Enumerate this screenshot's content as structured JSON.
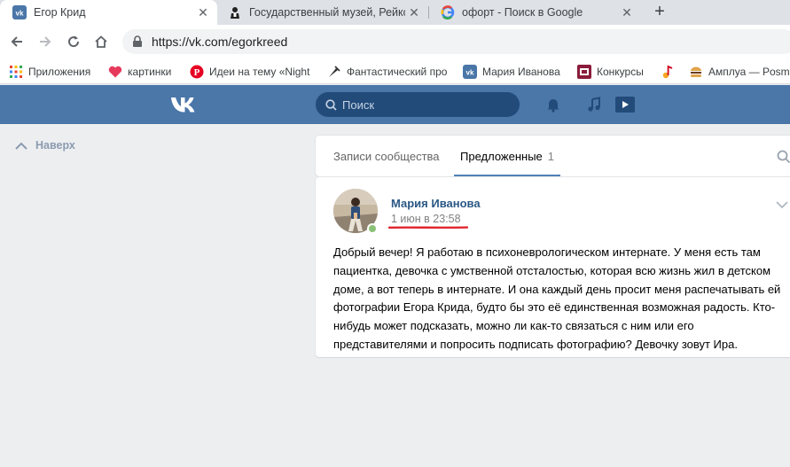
{
  "browser": {
    "tabs": [
      {
        "title": "Егор Крид",
        "icon": "vk-favicon",
        "active": true
      },
      {
        "title": "Государственный музей, Рейксмюсеум",
        "icon": "museum-favicon",
        "active": false
      },
      {
        "title": "офорт - Поиск в Google",
        "icon": "google-favicon",
        "active": false
      }
    ],
    "close_glyph": "✕",
    "newtab_glyph": "+",
    "url": "https://vk.com/egorkreed",
    "bookmarks": [
      {
        "label": "Приложения",
        "icon": "apps-grid-icon"
      },
      {
        "label": "картинки",
        "icon": "heart-icon"
      },
      {
        "label": "Идеи на тему «Night",
        "icon": "pinterest-icon"
      },
      {
        "label": "Фантастический про",
        "icon": "fantasy-icon"
      },
      {
        "label": "Мария Иванова",
        "icon": "vk-icon"
      },
      {
        "label": "Конкурсы",
        "icon": "contest-icon"
      },
      {
        "label": "",
        "icon": "music-note-icon"
      },
      {
        "label": "Амплуа — Posm",
        "icon": "burger-icon"
      }
    ]
  },
  "vk": {
    "search_placeholder": "Поиск",
    "up_label": "Наверх",
    "tabs": [
      {
        "label": "Записи сообщества"
      },
      {
        "label": "Предложенные",
        "count": "1"
      }
    ],
    "post": {
      "author": "Мария Иванова",
      "date": "1 июн в 23:58",
      "text": "Добрый вечер! Я работаю в психоневрологическом интернате. У меня есть там пациентка, девочка с умственной отсталостью, которая всю жизнь жил в детском доме, а вот теперь в интернате. И она каждый день просит меня распечатывать ей фотографии Егора Крида, будто бы это её единственная возможная радость. Кто-нибудь может подсказать, можно ли как-то связаться с ним или его представителями и попросить подписать фотографию? Девочку зовут Ира."
    },
    "colors": {
      "header": "#4a76a8",
      "link": "#2a5885",
      "annotation": "#e0262e",
      "online": "#8ac176"
    }
  }
}
